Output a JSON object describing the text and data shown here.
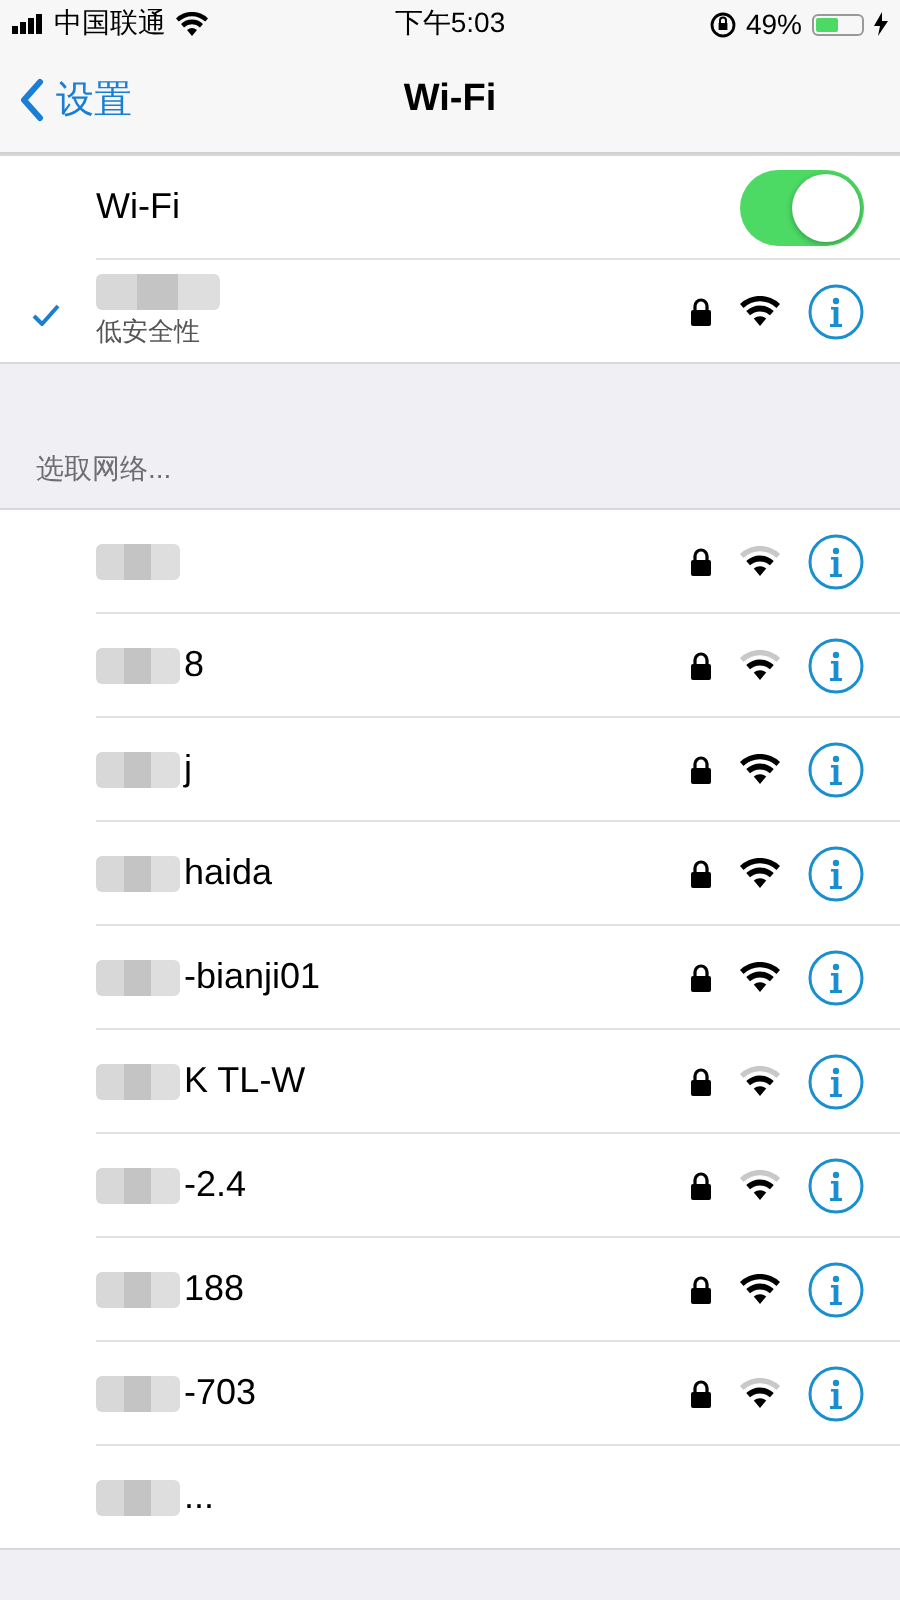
{
  "status_bar": {
    "carrier": "中国联通",
    "time": "下午5:03",
    "battery_text": "49%"
  },
  "nav": {
    "back": "设置",
    "title": "Wi-Fi"
  },
  "wifi_toggle": {
    "label": "Wi-Fi",
    "on": true
  },
  "connected": {
    "redacted": true,
    "subtitle": "低安全性",
    "checked": true,
    "locked": true,
    "strong": true
  },
  "section_header": "选取网络...",
  "networks": [
    {
      "redacted": true,
      "locked": true,
      "strong": false
    },
    {
      "name": "8",
      "redacted": true,
      "locked": true,
      "strong": false
    },
    {
      "name": "j",
      "redacted": true,
      "locked": true,
      "strong": true
    },
    {
      "name": "haida",
      "redacted": true,
      "locked": true,
      "strong": true
    },
    {
      "name": "-bianji01",
      "redacted": true,
      "locked": true,
      "strong": true
    },
    {
      "name": "K TL-W",
      "redacted": true,
      "locked": true,
      "strong": false
    },
    {
      "name": "-2.4",
      "redacted": true,
      "locked": true,
      "strong": false
    },
    {
      "name": "188",
      "redacted": true,
      "locked": true,
      "strong": true
    },
    {
      "name": "-703",
      "redacted": true,
      "locked": true,
      "strong": false
    }
  ],
  "other": {
    "name": "...",
    "redacted": true
  }
}
